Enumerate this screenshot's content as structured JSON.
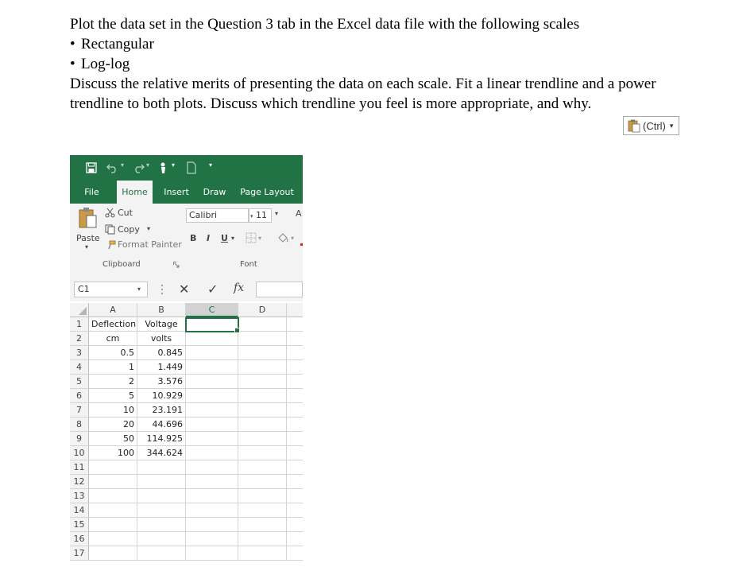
{
  "document": {
    "intro": "Plot the data set in the Question 3 tab in the Excel data file with the following scales",
    "bullets": [
      "Rectangular",
      "Log-log"
    ],
    "paragraph_line1": "Discuss the relative merits of presenting the data on each scale. Fit a linear trendline and a power",
    "paragraph_line2": "trendline to both plots. Discuss which trendline you feel is more appropriate, and why.",
    "bullet_char": "•"
  },
  "paste_options": {
    "label": "(Ctrl)",
    "caret": "▾"
  },
  "excel": {
    "colors": {
      "green": "#217346",
      "ribbon": "#f3f3f3",
      "gridline": "#d4d4d4"
    },
    "qat": {
      "more": "▾"
    },
    "tabs": [
      "File",
      "Home",
      "Insert",
      "Draw",
      "Page Layout"
    ],
    "active_tab": "Home",
    "clipboard": {
      "paste": "Paste",
      "cut": "Cut",
      "copy": "Copy",
      "format_painter": "Format Painter",
      "group_label": "Clipboard"
    },
    "font": {
      "name": "Calibri",
      "size": "11",
      "bold": "B",
      "italic": "I",
      "underline": "U",
      "group_label": "Font",
      "grow": "A"
    },
    "formula_bar": {
      "name_box": "C1",
      "cancel": "✕",
      "enter": "✓",
      "fx": "fx",
      "value": ""
    },
    "columns": [
      "A",
      "B",
      "C",
      "D"
    ],
    "rows": [
      {
        "n": "1",
        "a": "Deflection",
        "b": "Voltage"
      },
      {
        "n": "2",
        "a": "cm",
        "b": "volts"
      },
      {
        "n": "3",
        "a": "0.5",
        "b": "0.845"
      },
      {
        "n": "4",
        "a": "1",
        "b": "1.449"
      },
      {
        "n": "5",
        "a": "2",
        "b": "3.576"
      },
      {
        "n": "6",
        "a": "5",
        "b": "10.929"
      },
      {
        "n": "7",
        "a": "10",
        "b": "23.191"
      },
      {
        "n": "8",
        "a": "20",
        "b": "44.696"
      },
      {
        "n": "9",
        "a": "50",
        "b": "114.925"
      },
      {
        "n": "10",
        "a": "100",
        "b": "344.624"
      },
      {
        "n": "11",
        "a": "",
        "b": ""
      },
      {
        "n": "12",
        "a": "",
        "b": ""
      },
      {
        "n": "13",
        "a": "",
        "b": ""
      },
      {
        "n": "14",
        "a": "",
        "b": ""
      },
      {
        "n": "15",
        "a": "",
        "b": ""
      },
      {
        "n": "16",
        "a": "",
        "b": ""
      },
      {
        "n": "17",
        "a": "",
        "b": ""
      }
    ],
    "active_cell": "C1"
  }
}
